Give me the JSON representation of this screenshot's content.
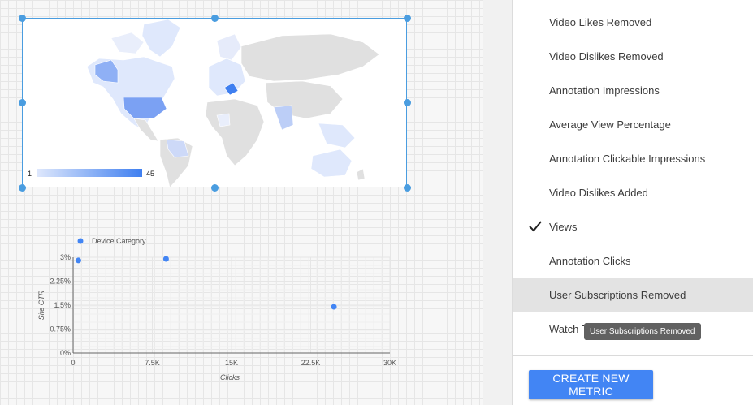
{
  "map": {
    "legend_min": "1",
    "legend_max": "45",
    "color_low": "#dfe8fc",
    "color_high": "#3f7ff0"
  },
  "metrics_panel": {
    "items": [
      {
        "label": "Video Likes Removed",
        "checked": false,
        "hovered": false
      },
      {
        "label": "Video Dislikes Removed",
        "checked": false,
        "hovered": false
      },
      {
        "label": "Annotation Impressions",
        "checked": false,
        "hovered": false
      },
      {
        "label": "Average View Percentage",
        "checked": false,
        "hovered": false
      },
      {
        "label": "Annotation Clickable Impressions",
        "checked": false,
        "hovered": false
      },
      {
        "label": "Video Dislikes Added",
        "checked": false,
        "hovered": false
      },
      {
        "label": "Views",
        "checked": true,
        "hovered": false
      },
      {
        "label": "Annotation Clicks",
        "checked": false,
        "hovered": false
      },
      {
        "label": "User Subscriptions Removed",
        "checked": false,
        "hovered": true
      },
      {
        "label": "Watch Time",
        "checked": false,
        "hovered": false
      }
    ],
    "tooltip": "User Subscriptions Removed",
    "create_button": "CREATE NEW METRIC",
    "accent_color": "#4285f4"
  },
  "chart_data": {
    "type": "scatter",
    "legend": [
      "Device Category"
    ],
    "xlabel": "Clicks",
    "ylabel": "Site CTR",
    "x_ticks": [
      "0",
      "7.5K",
      "15K",
      "22.5K",
      "30K"
    ],
    "y_ticks": [
      "0%",
      "0.75%",
      "1.5%",
      "2.25%",
      "3%"
    ],
    "xlim": [
      0,
      30000
    ],
    "ylim": [
      0,
      3
    ],
    "series": [
      {
        "name": "Device Category",
        "color": "#4285f4",
        "points": [
          [
            500,
            2.9
          ],
          [
            8800,
            2.95
          ],
          [
            24700,
            1.45
          ]
        ]
      }
    ],
    "grid": true,
    "legend_position": "top-left"
  }
}
